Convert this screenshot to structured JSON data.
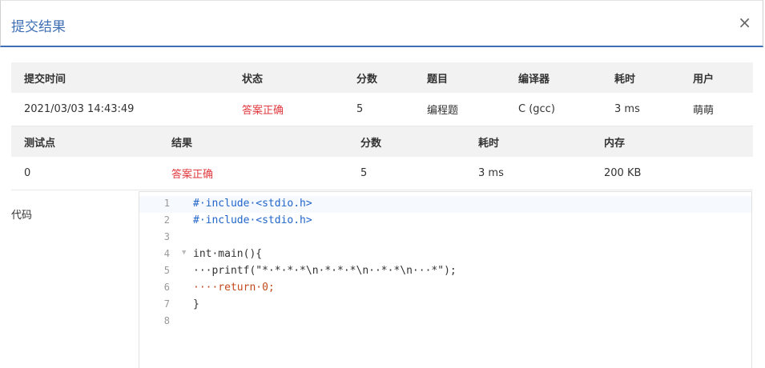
{
  "modal": {
    "title": "提交结果",
    "close_label": "×"
  },
  "submission": {
    "headers": [
      "提交时间",
      "状态",
      "分数",
      "题目",
      "编译器",
      "耗时",
      "用户"
    ],
    "row": [
      "2021/03/03 14:43:49",
      "答案正确",
      "5",
      "编程题",
      "C (gcc)",
      "3 ms",
      "萌萌"
    ]
  },
  "testpoints": {
    "headers": [
      "测试点",
      "结果",
      "分数",
      "耗时",
      "内存"
    ],
    "row": [
      "0",
      "答案正确",
      "5",
      "3 ms",
      "200 KB"
    ]
  },
  "code": {
    "label": "代码",
    "line_numbers": [
      "1",
      "2",
      "3",
      "4",
      "5",
      "6",
      "7",
      "8"
    ],
    "lines": [
      "#·include·<stdio.h>",
      "#·include·<stdio.h>",
      "",
      "int·main(){",
      "···printf(\"*·*·*·*\\n·*·*·*\\n··*·*\\n···*\");",
      "····return·0;",
      "}",
      ""
    ]
  },
  "colors": {
    "accent": "#3f6fb5",
    "status_accepted": "#e0393e"
  }
}
